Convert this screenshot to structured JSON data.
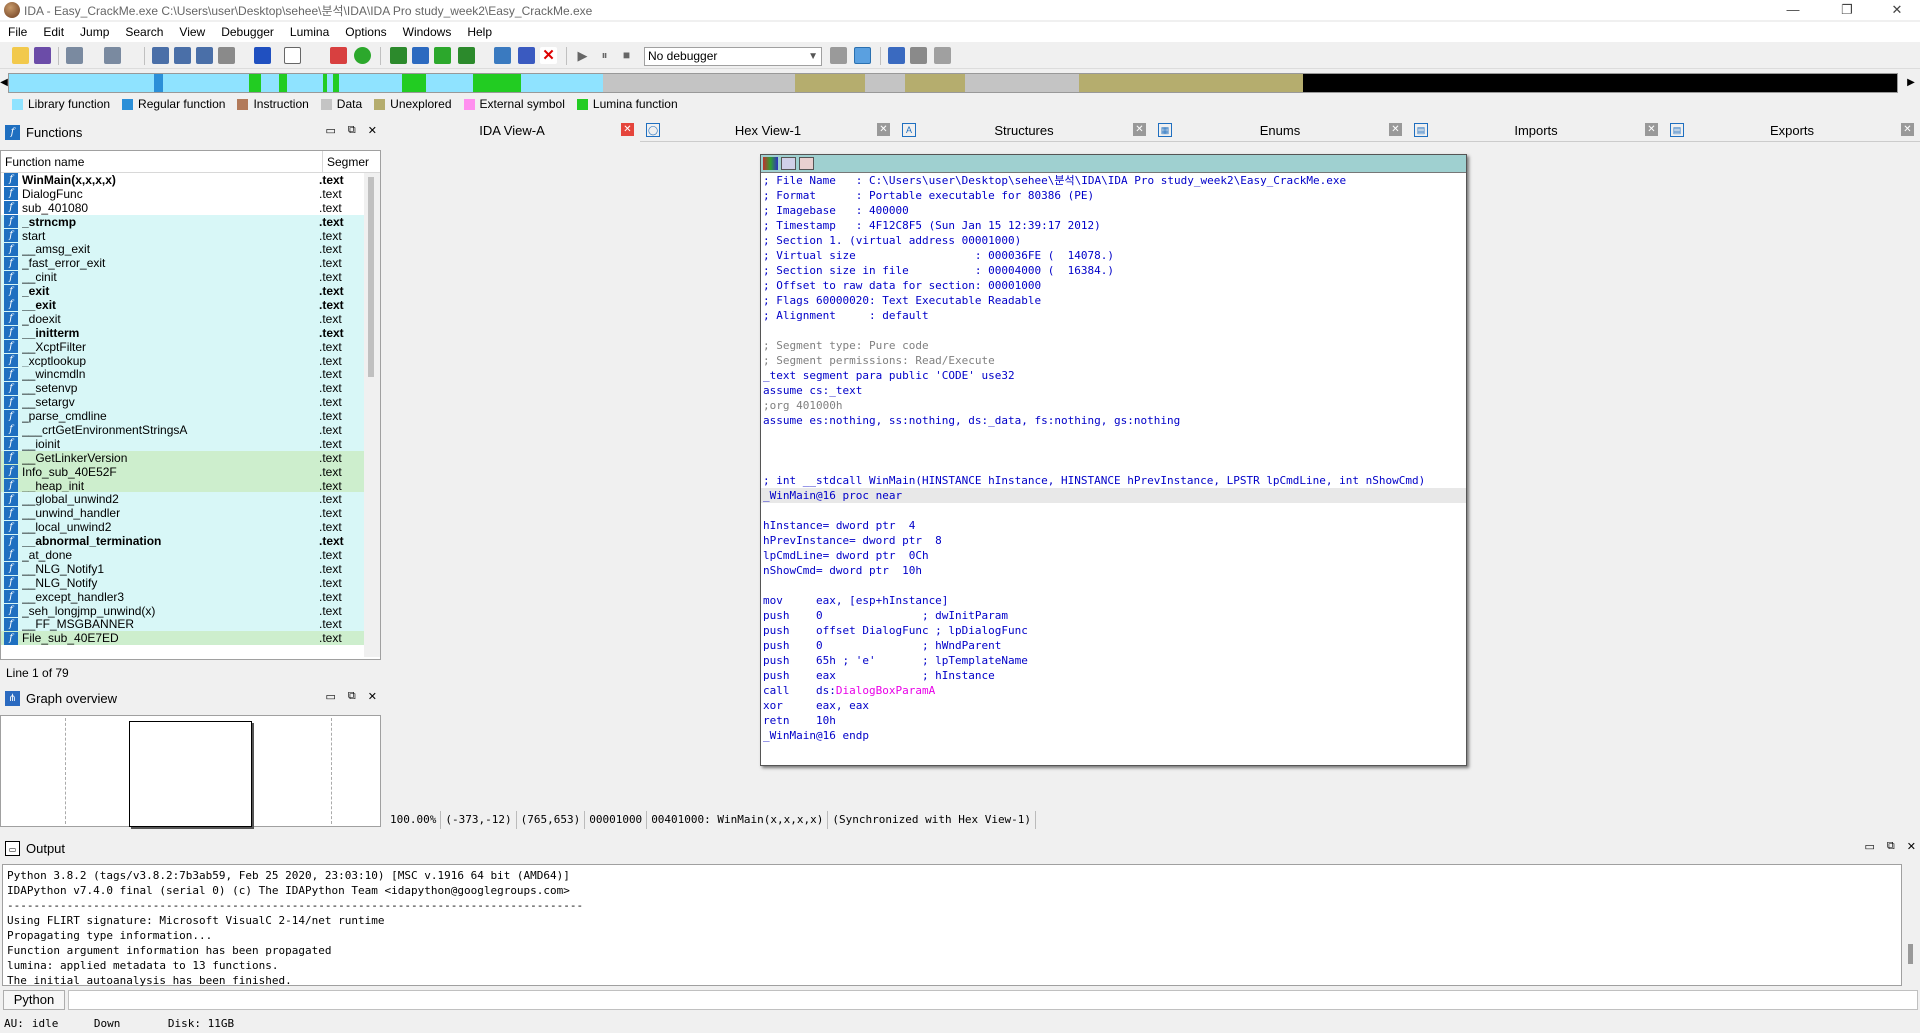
{
  "window": {
    "title": "IDA - Easy_CrackMe.exe C:\\Users\\user\\Desktop\\sehee\\분석\\IDA\\IDA Pro study_week2\\Easy_CrackMe.exe",
    "minimize": "—",
    "restore": "❐",
    "close": "✕"
  },
  "menu": [
    "File",
    "Edit",
    "Jump",
    "Search",
    "View",
    "Debugger",
    "Lumina",
    "Options",
    "Windows",
    "Help"
  ],
  "toolbar": {
    "debugger_select": "No debugger"
  },
  "legend": [
    {
      "label": "Library function",
      "color": "#8fe3ff"
    },
    {
      "label": "Regular function",
      "color": "#2b8fd8"
    },
    {
      "label": "Instruction",
      "color": "#b27a5a"
    },
    {
      "label": "Data",
      "color": "#c4c4c4"
    },
    {
      "label": "Unexplored",
      "color": "#b5ad6e"
    },
    {
      "label": "External symbol",
      "color": "#ff8fef"
    },
    {
      "label": "Lumina function",
      "color": "#22cc22"
    }
  ],
  "functions": {
    "title": "Functions",
    "col_name": "Function name",
    "col_segment": "Segmer",
    "rows": [
      {
        "name": "WinMain(x,x,x,x)",
        "seg": ".text",
        "bold": true,
        "bg": "#ffffff"
      },
      {
        "name": "DialogFunc",
        "seg": ".text",
        "bold": false,
        "bg": "#ffffff"
      },
      {
        "name": "sub_401080",
        "seg": ".text",
        "bold": false,
        "bg": "#ffffff"
      },
      {
        "name": "_strncmp",
        "seg": ".text",
        "bold": true,
        "bg": "#d8f7f7"
      },
      {
        "name": "start",
        "seg": ".text",
        "bold": false,
        "bg": "#d8f7f7"
      },
      {
        "name": "__amsg_exit",
        "seg": ".text",
        "bold": false,
        "bg": "#d8f7f7"
      },
      {
        "name": "_fast_error_exit",
        "seg": ".text",
        "bold": false,
        "bg": "#d8f7f7"
      },
      {
        "name": "__cinit",
        "seg": ".text",
        "bold": false,
        "bg": "#d8f7f7"
      },
      {
        "name": "_exit",
        "seg": ".text",
        "bold": true,
        "bg": "#d8f7f7"
      },
      {
        "name": "__exit",
        "seg": ".text",
        "bold": true,
        "bg": "#d8f7f7"
      },
      {
        "name": "_doexit",
        "seg": ".text",
        "bold": false,
        "bg": "#d8f7f7"
      },
      {
        "name": "__initterm",
        "seg": ".text",
        "bold": true,
        "bg": "#d8f7f7"
      },
      {
        "name": "__XcptFilter",
        "seg": ".text",
        "bold": false,
        "bg": "#d8f7f7"
      },
      {
        "name": "_xcptlookup",
        "seg": ".text",
        "bold": false,
        "bg": "#d8f7f7"
      },
      {
        "name": "__wincmdln",
        "seg": ".text",
        "bold": false,
        "bg": "#d8f7f7"
      },
      {
        "name": "__setenvp",
        "seg": ".text",
        "bold": false,
        "bg": "#d8f7f7"
      },
      {
        "name": "__setargv",
        "seg": ".text",
        "bold": false,
        "bg": "#d8f7f7"
      },
      {
        "name": "_parse_cmdline",
        "seg": ".text",
        "bold": false,
        "bg": "#d8f7f7"
      },
      {
        "name": "___crtGetEnvironmentStringsA",
        "seg": ".text",
        "bold": false,
        "bg": "#d8f7f7"
      },
      {
        "name": "__ioinit",
        "seg": ".text",
        "bold": false,
        "bg": "#d8f7f7"
      },
      {
        "name": "__GetLinkerVersion",
        "seg": ".text",
        "bold": false,
        "bg": "#cdeecd"
      },
      {
        "name": "Info_sub_40E52F",
        "seg": ".text",
        "bold": false,
        "bg": "#cdeecd"
      },
      {
        "name": "__heap_init",
        "seg": ".text",
        "bold": false,
        "bg": "#cdeecd"
      },
      {
        "name": "__global_unwind2",
        "seg": ".text",
        "bold": false,
        "bg": "#d8f7f7"
      },
      {
        "name": "__unwind_handler",
        "seg": ".text",
        "bold": false,
        "bg": "#d8f7f7"
      },
      {
        "name": "__local_unwind2",
        "seg": ".text",
        "bold": false,
        "bg": "#d8f7f7"
      },
      {
        "name": "__abnormal_termination",
        "seg": ".text",
        "bold": true,
        "bg": "#d8f7f7"
      },
      {
        "name": "_at_done",
        "seg": ".text",
        "bold": false,
        "bg": "#d8f7f7"
      },
      {
        "name": "__NLG_Notify1",
        "seg": ".text",
        "bold": false,
        "bg": "#d8f7f7"
      },
      {
        "name": "__NLG_Notify",
        "seg": ".text",
        "bold": false,
        "bg": "#d8f7f7"
      },
      {
        "name": "__except_handler3",
        "seg": ".text",
        "bold": false,
        "bg": "#d8f7f7"
      },
      {
        "name": "_seh_longjmp_unwind(x)",
        "seg": ".text",
        "bold": false,
        "bg": "#d8f7f7"
      },
      {
        "name": "__FF_MSGBANNER",
        "seg": ".text",
        "bold": false,
        "bg": "#d8f7f7"
      },
      {
        "name": "File_sub_40E7ED",
        "seg": ".text",
        "bold": false,
        "bg": "#cdeecd"
      }
    ],
    "status": "Line 1 of 79"
  },
  "graph_overview": {
    "title": "Graph overview"
  },
  "tabs": [
    {
      "label": "IDA View-A",
      "icon": "",
      "active": true
    },
    {
      "label": "Hex View-1",
      "icon": "◯",
      "active": false
    },
    {
      "label": "Structures",
      "icon": "A",
      "active": false
    },
    {
      "label": "Enums",
      "icon": "▦",
      "active": false
    },
    {
      "label": "Imports",
      "icon": "▤",
      "active": false
    },
    {
      "label": "Exports",
      "icon": "▤",
      "active": false
    }
  ],
  "disasm": [
    {
      "t": "; File Name   : C:\\Users\\user\\Desktop\\sehee\\분석\\IDA\\IDA Pro study_week2\\Easy_CrackMe.exe",
      "c": "blue"
    },
    {
      "t": "; Format      : Portable executable for 80386 (PE)",
      "c": "blue"
    },
    {
      "t": "; Imagebase   : 400000",
      "c": "blue"
    },
    {
      "t": "; Timestamp   : 4F12C8F5 (Sun Jan 15 12:39:17 2012)",
      "c": "blue"
    },
    {
      "t": "; Section 1. (virtual address 00001000)",
      "c": "blue"
    },
    {
      "t": "; Virtual size                  : 000036FE (  14078.)",
      "c": "blue"
    },
    {
      "t": "; Section size in file          : 00004000 (  16384.)",
      "c": "blue"
    },
    {
      "t": "; Offset to raw data for section: 00001000",
      "c": "blue"
    },
    {
      "t": "; Flags 60000020: Text Executable Readable",
      "c": "blue"
    },
    {
      "t": "; Alignment     : default",
      "c": "blue"
    },
    {
      "t": "",
      "c": "blue"
    },
    {
      "t": "; Segment type: Pure code",
      "c": "gray"
    },
    {
      "t": "; Segment permissions: Read/Execute",
      "c": "gray"
    },
    {
      "t": "_text segment para public 'CODE' use32",
      "c": "blue"
    },
    {
      "t": "assume cs:_text",
      "c": "blue"
    },
    {
      "t": ";org 401000h",
      "c": "gray"
    },
    {
      "t": "assume es:nothing, ss:nothing, ds:_data, fs:nothing, gs:nothing",
      "c": "blue"
    },
    {
      "t": "",
      "c": "blue"
    },
    {
      "t": "",
      "c": "blue"
    },
    {
      "t": "",
      "c": "blue"
    },
    {
      "t": "; int __stdcall WinMain(HINSTANCE hInstance, HINSTANCE hPrevInstance, LPSTR lpCmdLine, int nShowCmd)",
      "c": "blue"
    },
    {
      "t": "_WinMain@16 proc near",
      "c": "blue hl"
    },
    {
      "t": "",
      "c": "blue"
    },
    {
      "t": "hInstance= dword ptr  4",
      "c": "blue"
    },
    {
      "t": "hPrevInstance= dword ptr  8",
      "c": "blue"
    },
    {
      "t": "lpCmdLine= dword ptr  0Ch",
      "c": "blue"
    },
    {
      "t": "nShowCmd= dword ptr  10h",
      "c": "blue"
    },
    {
      "t": "",
      "c": "blue"
    },
    {
      "t": "mov     eax, [esp+hInstance]",
      "c": "blue"
    },
    {
      "t": "push    0               ; dwInitParam",
      "c": "blue"
    },
    {
      "t": "push    offset DialogFunc ; lpDialogFunc",
      "c": "blue"
    },
    {
      "t": "push    0               ; hWndParent",
      "c": "blue"
    },
    {
      "t": "push    65h ; 'e'       ; lpTemplateName",
      "c": "blue"
    },
    {
      "t": "push    eax             ; hInstance",
      "c": "blue"
    },
    {
      "t": "call    ds:",
      "c": "blue",
      "mag": "DialogBoxParamA"
    },
    {
      "t": "xor     eax, eax",
      "c": "blue"
    },
    {
      "t": "retn    10h",
      "c": "blue"
    },
    {
      "t": "_WinMain@16 endp",
      "c": "blue"
    }
  ],
  "ida_status": [
    "100.00%",
    "(-373,-12)",
    "(765,653)",
    "00001000",
    "00401000: WinMain(x,x,x,x)",
    "(Synchronized with Hex View-1)"
  ],
  "output": {
    "title": "Output",
    "lines": [
      "Python 3.8.2 (tags/v3.8.2:7b3ab59, Feb 25 2020, 23:03:10) [MSC v.1916 64 bit (AMD64)]",
      "IDAPython v7.4.0 final (serial 0) (c) The IDAPython Team <idapython@googlegroups.com>",
      "---------------------------------------------------------------------------------------",
      "Using FLIRT signature: Microsoft VisualC 2-14/net runtime",
      "Propagating type information...",
      "Function argument information has been propagated",
      "lumina: applied metadata to 13 functions.",
      "The initial autoanalysis has been finished."
    ],
    "python_button": "Python"
  },
  "statusbar": {
    "au": "AU:",
    "state": "idle",
    "dir": "Down",
    "disk": "Disk: 11GB"
  }
}
